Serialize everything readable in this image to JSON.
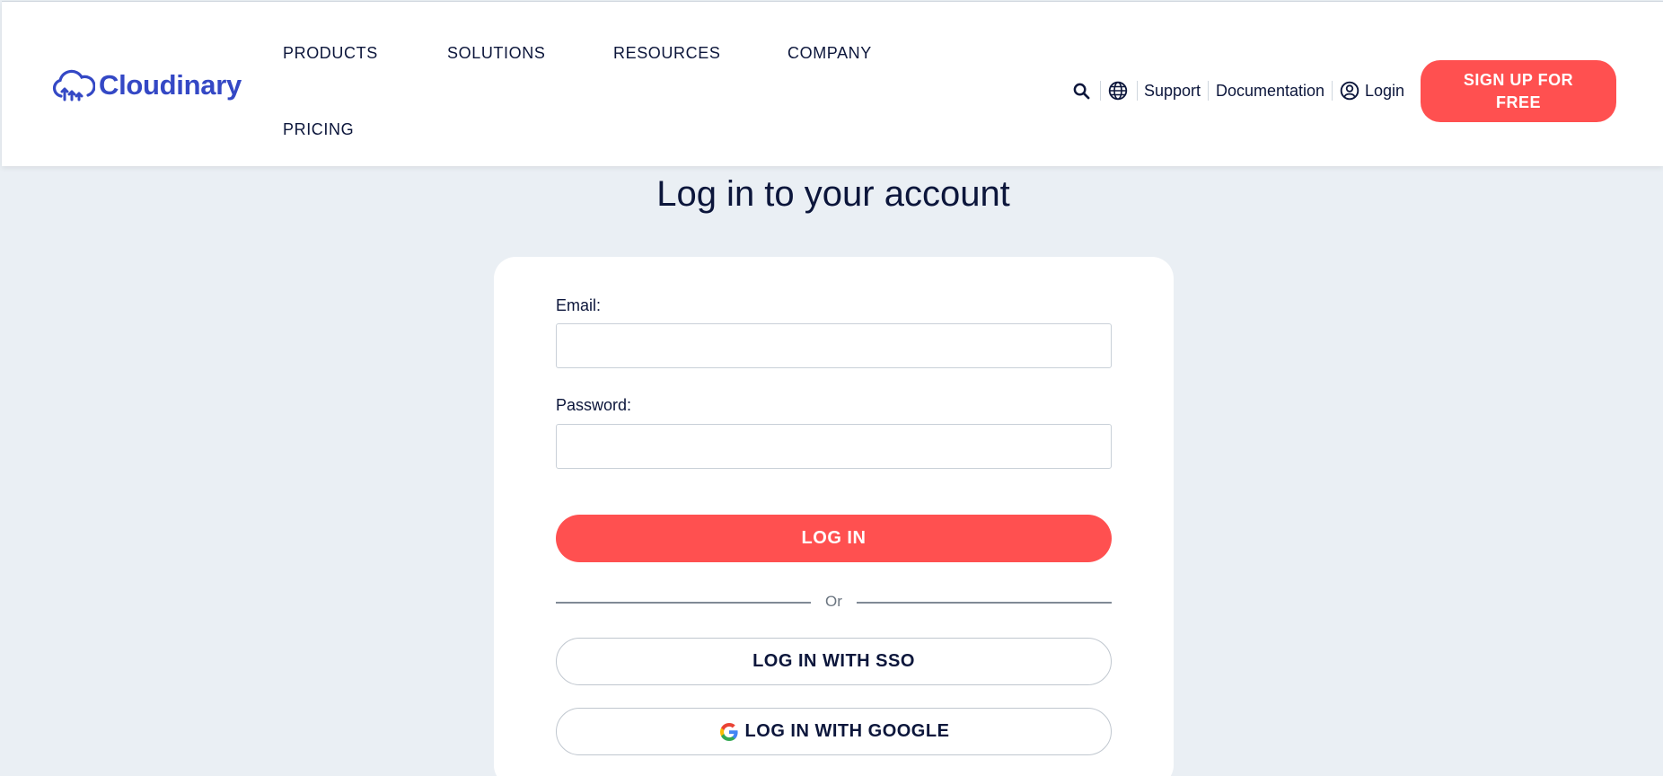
{
  "header": {
    "brand": "Cloudinary",
    "nav": [
      {
        "label": "PRODUCTS"
      },
      {
        "label": "SOLUTIONS"
      },
      {
        "label": "RESOURCES"
      },
      {
        "label": "COMPANY"
      },
      {
        "label": "PRICING"
      }
    ],
    "utility": {
      "search_icon": "search-icon",
      "language_icon": "globe-icon",
      "support": "Support",
      "documentation": "Documentation",
      "login_icon": "user-circle-icon",
      "login": "Login"
    },
    "signup_label": "SIGN UP FOR FREE"
  },
  "main": {
    "title": "Log in to your account",
    "form": {
      "email_label": "Email:",
      "email_value": "",
      "email_placeholder": "",
      "password_label": "Password:",
      "password_value": "",
      "password_placeholder": "",
      "login_button": "LOG IN",
      "or_text": "Or",
      "sso_button": "LOG IN WITH SSO",
      "google_button": "LOG IN WITH GOOGLE"
    }
  },
  "colors": {
    "brand_blue": "#3448c5",
    "accent_red": "#ff5050",
    "text_navy": "#0c163b",
    "page_bg": "#eaeff4"
  }
}
